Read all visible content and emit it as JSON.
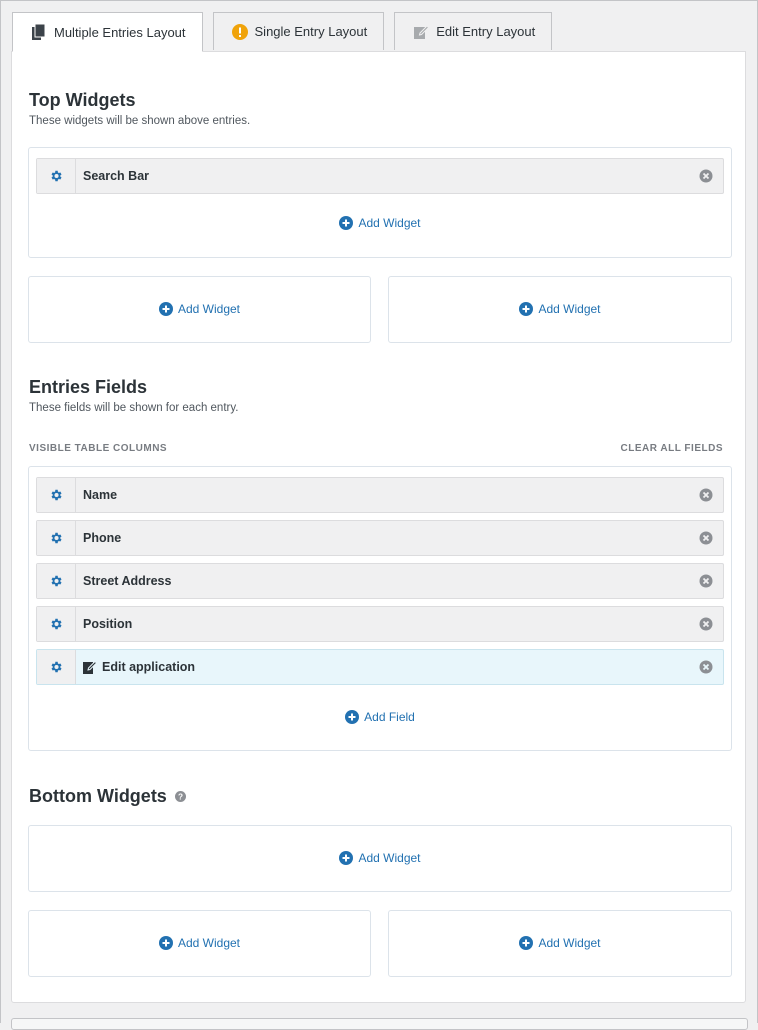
{
  "tabs": [
    {
      "label": "Multiple Entries Layout",
      "icon": "copy-icon",
      "active": true
    },
    {
      "label": "Single Entry Layout",
      "icon": "warning-icon",
      "active": false
    },
    {
      "label": "Edit Entry Layout",
      "icon": "edit-icon",
      "active": false
    }
  ],
  "top_widgets": {
    "title": "Top Widgets",
    "description": "These widgets will be shown above entries.",
    "items": [
      {
        "label": "Search Bar"
      }
    ],
    "add_label": "Add Widget",
    "left_add_label": "Add Widget",
    "right_add_label": "Add Widget"
  },
  "entries_fields": {
    "title": "Entries Fields",
    "description": "These fields will be shown for each entry.",
    "columns_label": "VISIBLE TABLE COLUMNS",
    "clear_label": "CLEAR ALL FIELDS",
    "items": [
      {
        "label": "Name"
      },
      {
        "label": "Phone"
      },
      {
        "label": "Street Address"
      },
      {
        "label": "Position"
      },
      {
        "label": "Edit application",
        "highlighted": true
      }
    ],
    "add_label": "Add Field"
  },
  "bottom_widgets": {
    "title": "Bottom Widgets",
    "add_label": "Add Widget",
    "left_add_label": "Add Widget",
    "right_add_label": "Add Widget"
  },
  "colors": {
    "accent": "#2271b1",
    "warning": "#f0a30a",
    "highlight_row": "#e8f6fb"
  }
}
